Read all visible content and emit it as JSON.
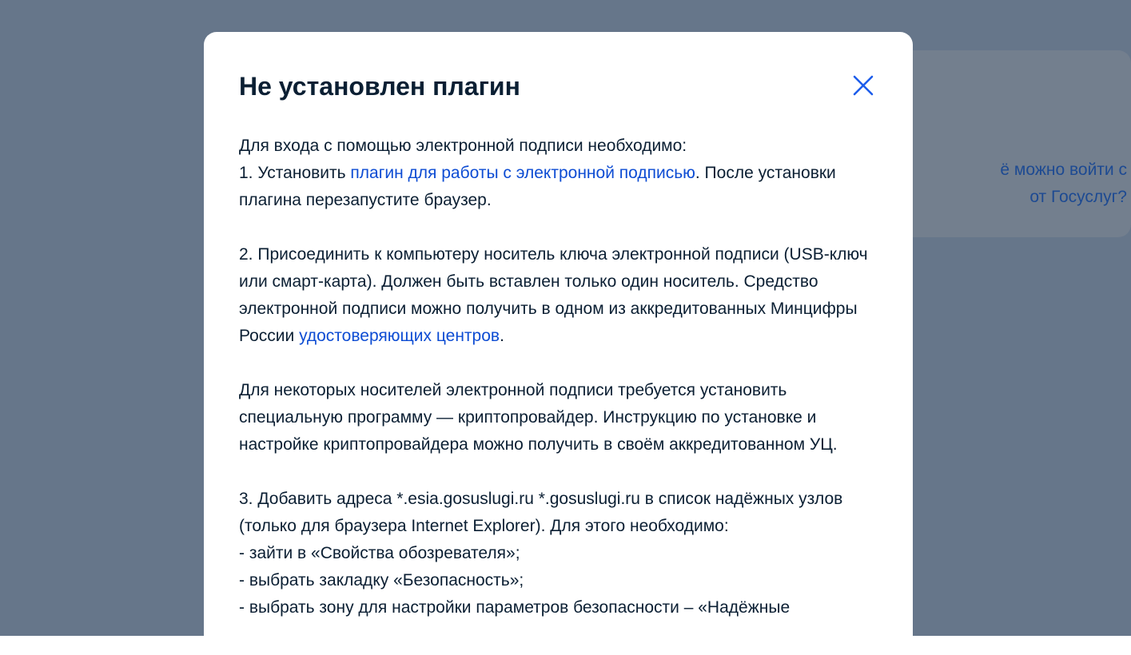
{
  "background": {
    "link_line1": "ё можно войти с",
    "link_line2": "от Госуслуг?"
  },
  "modal": {
    "title": "Не установлен плагин",
    "close_icon": "close-icon",
    "p1": {
      "line1": "Для входа с помощью электронной подписи необходимо:",
      "step1_prefix": "1. Установить ",
      "step1_link": "плагин для работы с электронной подписью",
      "step1_suffix": ". После установки плагина перезапустите браузер."
    },
    "p2": {
      "text_before": "2. Присоединить к компьютеру носитель ключа электронной подписи (USB-ключ или смарт-карта). Должен быть вставлен только один носитель. Средство электронной подписи можно получить в одном из аккредитованных Минцифры России ",
      "link": "удостоверяющих центров",
      "text_after": "."
    },
    "p3": "Для некоторых носителей электронной подписи требуется установить специальную программу — криптопровайдер. Инструкцию по установке и настройке криптопровайдера можно получить в своём аккредитованном УЦ.",
    "p4": {
      "line1": "3. Добавить адреса *.esia.gosuslugi.ru *.gosuslugi.ru в список надёжных узлов (только для браузера Internet Explorer). Для этого необходимо:",
      "item1": "- зайти в «Свойства обозревателя»;",
      "item2": "- выбрать закладку «Безопасность»;",
      "item3": "- выбрать зону для настройки параметров безопасности – «Надёжные"
    }
  },
  "colors": {
    "overlay": "#66768a",
    "link": "#0d4cd3",
    "text": "#0b1f33",
    "close": "#1d5deb"
  }
}
